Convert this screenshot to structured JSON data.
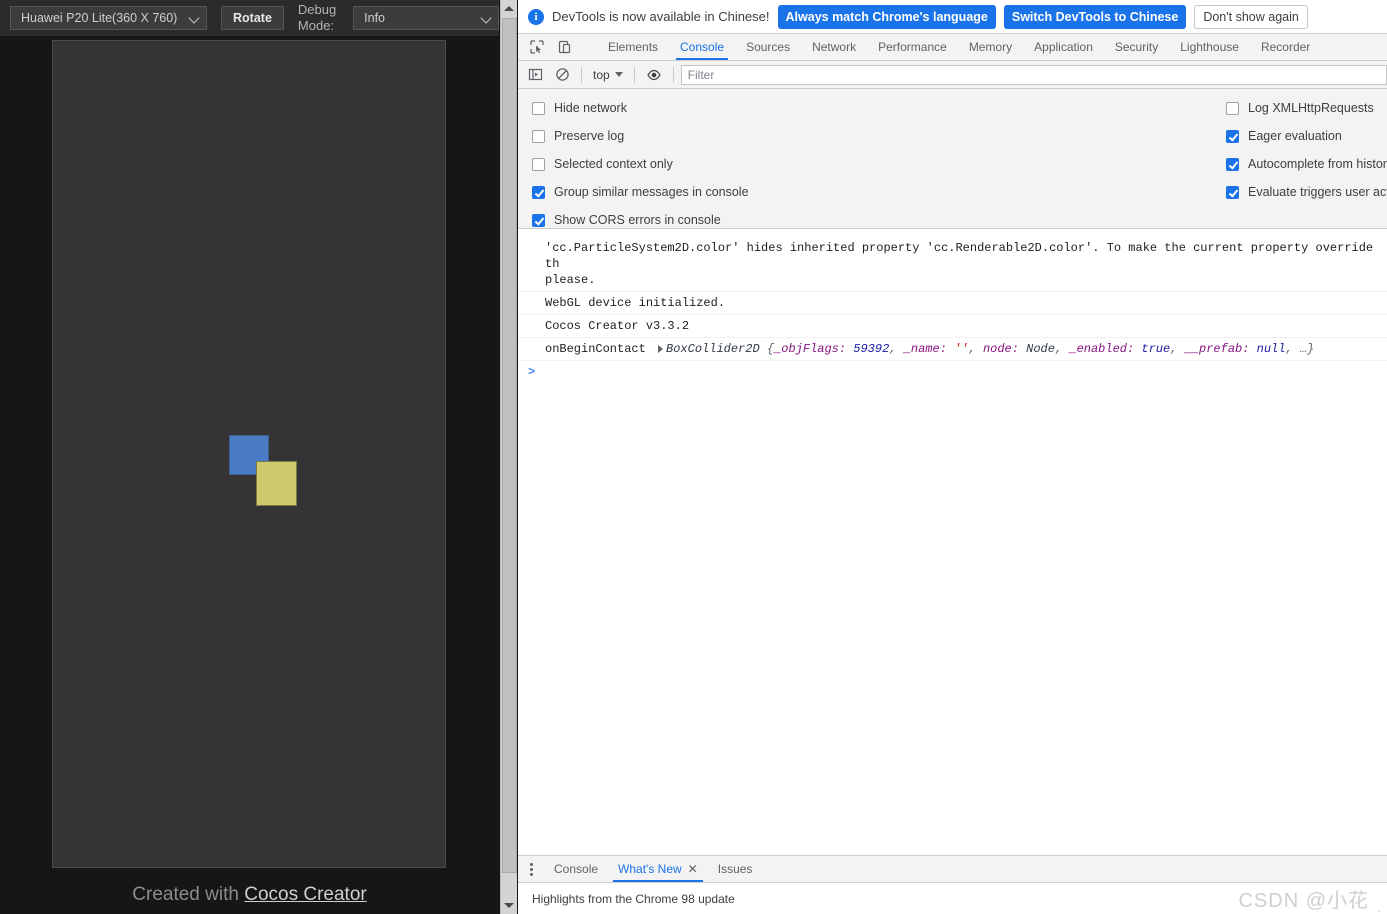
{
  "preview": {
    "device_select": {
      "value": "Huawei P20 Lite(360 X 760)",
      "icon": "chevron-down-icon"
    },
    "rotate_button": "Rotate",
    "debug_mode_label": "Debug Mode:",
    "debug_select": {
      "value": "Info",
      "icon": "chevron-down-icon"
    },
    "footer": {
      "prefix": "Created with ",
      "link": "Cocos Creator"
    },
    "canvas": {
      "background": "#343434",
      "shapes": [
        {
          "name": "blue-square",
          "color": "#4a7cc6"
        },
        {
          "name": "yellow-square",
          "color": "#cfca6e"
        }
      ]
    }
  },
  "devtools": {
    "infobar": {
      "message": "DevTools is now available in Chinese!",
      "primary_button": "Always match Chrome's language",
      "secondary_button": "Switch DevTools to Chinese",
      "dismiss_button": "Don't show again",
      "accent": "#1a73e8"
    },
    "tabs": [
      {
        "label": "Elements",
        "active": false
      },
      {
        "label": "Console",
        "active": true
      },
      {
        "label": "Sources",
        "active": false
      },
      {
        "label": "Network",
        "active": false
      },
      {
        "label": "Performance",
        "active": false
      },
      {
        "label": "Memory",
        "active": false
      },
      {
        "label": "Application",
        "active": false
      },
      {
        "label": "Security",
        "active": false
      },
      {
        "label": "Lighthouse",
        "active": false
      },
      {
        "label": "Recorder",
        "active": false
      }
    ],
    "console_toolbar": {
      "sidebar_toggle_icon": "console-sidebar-icon",
      "clear_icon": "clear-console-icon",
      "context": "top",
      "eye_icon": "live-expression-icon",
      "filter_placeholder": "Filter"
    },
    "settings": {
      "left": [
        {
          "label": "Hide network",
          "checked": false
        },
        {
          "label": "Preserve log",
          "checked": false
        },
        {
          "label": "Selected context only",
          "checked": false
        },
        {
          "label": "Group similar messages in console",
          "checked": true
        },
        {
          "label": "Show CORS errors in console",
          "checked": true
        }
      ],
      "right": [
        {
          "label": "Log XMLHttpRequests",
          "checked": false
        },
        {
          "label": "Eager evaluation",
          "checked": true
        },
        {
          "label": "Autocomplete from history",
          "checked": true
        },
        {
          "label": "Evaluate triggers user activation",
          "checked": true
        }
      ]
    },
    "messages": {
      "warning_line1": "'cc.ParticleSystem2D.color' hides inherited property 'cc.Renderable2D.color'. To make the current property override th",
      "warning_line2": "please.",
      "webgl": "WebGL device initialized.",
      "cocos": "Cocos Creator v3.3.2",
      "contact": {
        "fn": "onBeginContact",
        "type": "BoxCollider2D",
        "open_brace": "{",
        "k1": "_objFlags:",
        "v1": "59392",
        "k2": "_name:",
        "v2": "''",
        "k3": "node:",
        "v3": "Node",
        "k4": "_enabled:",
        "v4": "true",
        "k5": "__prefab:",
        "v5": "null",
        "ellipsis": "…",
        "close_brace": "}",
        "comma": ","
      },
      "prompt": ">"
    },
    "drawer": {
      "tabs": [
        {
          "label": "Console",
          "active": false,
          "closable": false
        },
        {
          "label": "What's New",
          "active": true,
          "closable": true,
          "close": "✕"
        },
        {
          "label": "Issues",
          "active": false,
          "closable": false
        }
      ],
      "content": "Highlights from the Chrome 98 update"
    },
    "watermark": {
      "text": "CSDN @小花",
      "dot": "."
    }
  }
}
